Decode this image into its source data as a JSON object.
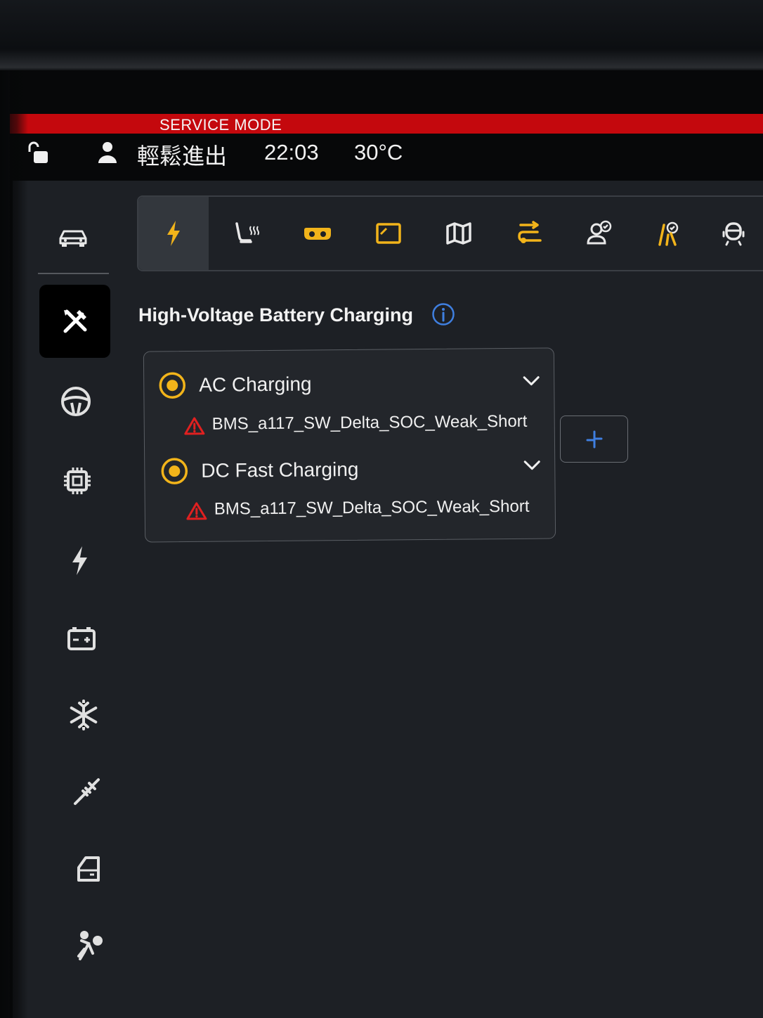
{
  "status_bar": {
    "service_mode_label": "SERVICE MODE",
    "user_name": "輕鬆進出",
    "time": "22:03",
    "temperature": "30°C"
  },
  "sidebar": {
    "items": [
      {
        "icon": "car-icon"
      },
      {
        "icon": "tools-icon",
        "selected": true
      },
      {
        "icon": "steering-wheel-icon"
      },
      {
        "icon": "chip-icon"
      },
      {
        "icon": "lightning-icon"
      },
      {
        "icon": "battery-icon"
      },
      {
        "icon": "snowflake-icon"
      },
      {
        "icon": "shock-absorber-icon"
      },
      {
        "icon": "door-icon"
      },
      {
        "icon": "airbag-icon"
      }
    ]
  },
  "tabs": [
    {
      "icon": "charging-bolt-icon",
      "active": true
    },
    {
      "icon": "seat-heat-icon"
    },
    {
      "icon": "headlight-icon"
    },
    {
      "icon": "display-icon"
    },
    {
      "icon": "map-icon"
    },
    {
      "icon": "route-icon"
    },
    {
      "icon": "driver-check-icon"
    },
    {
      "icon": "lane-assist-icon"
    },
    {
      "icon": "driver-monitor-icon"
    }
  ],
  "section": {
    "title": "High-Voltage Battery Charging"
  },
  "charging_items": [
    {
      "label": "AC Charging",
      "fault": "BMS_a117_SW_Delta_SOC_Weak_Short"
    },
    {
      "label": "DC Fast Charging",
      "fault": "BMS_a117_SW_Delta_SOC_Weak_Short"
    }
  ],
  "colors": {
    "service_red": "#c4080d",
    "accent_amber": "#f2b41a",
    "warning_red": "#e02020",
    "info_blue": "#3f7fe0"
  }
}
